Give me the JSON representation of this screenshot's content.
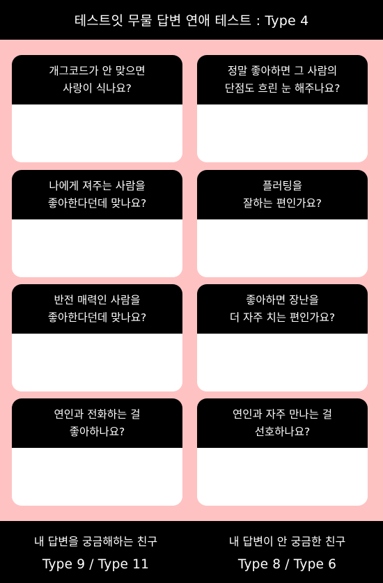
{
  "header": {
    "title": "테스트잇 무물 답변 연애 테스트 : Type 4"
  },
  "cards": [
    {
      "question": "개그코드가 안 맞으면\n사랑이 식나요?",
      "answer": ""
    },
    {
      "question": "정말 좋아하면 그 사람의\n단점도 흐린 눈 해주나요?",
      "answer": ""
    },
    {
      "question": "나에게 져주는 사람을\n좋아한다던데 맞나요?",
      "answer": ""
    },
    {
      "question": "플러팅을\n잘하는 편인가요?",
      "answer": ""
    },
    {
      "question": "반전 매력인 사람을\n좋아한다던데 맞나요?",
      "answer": ""
    },
    {
      "question": "좋아하면 장난을\n더 자주 치는 편인가요?",
      "answer": ""
    },
    {
      "question": "연인과 전화하는 걸\n좋아하나요?",
      "answer": ""
    },
    {
      "question": "연인과 자주 만나는 걸\n선호하나요?",
      "answer": ""
    }
  ],
  "footer": {
    "left": {
      "label": "내 답변을 궁금해하는 친구",
      "types": "Type 9 / Type 11"
    },
    "right": {
      "label": "내 답변이 안 궁금한 친구",
      "types": "Type 8 / Type 6"
    }
  }
}
